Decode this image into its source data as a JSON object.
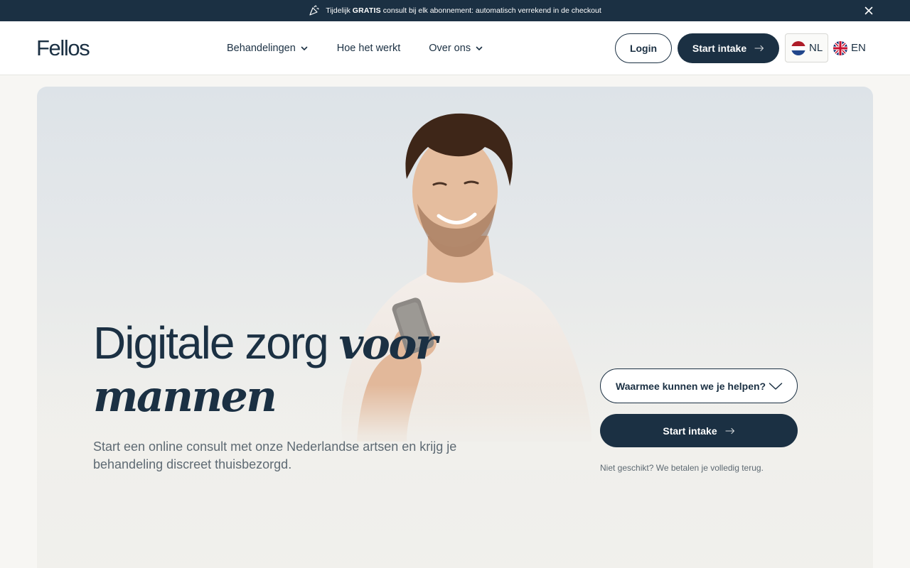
{
  "announcement": {
    "prefix": "Tijdelijk ",
    "highlight": "GRATIS",
    "suffix": " consult bij elk abonnement: automatisch verrekend in de checkout"
  },
  "header": {
    "logo": "Fellos",
    "nav": [
      {
        "label": "Behandelingen",
        "has_dropdown": true
      },
      {
        "label": "Hoe het werkt",
        "has_dropdown": false
      },
      {
        "label": "Over ons",
        "has_dropdown": true
      }
    ],
    "login_label": "Login",
    "start_label": "Start intake",
    "languages": [
      {
        "code": "NL",
        "active": true
      },
      {
        "code": "EN",
        "active": false
      }
    ]
  },
  "hero": {
    "headline_plain": "Digitale zorg ",
    "headline_italic_1": "voor",
    "headline_italic_2": "mannen",
    "subtext": "Start een online consult met onze Nederlandse artsen en krijg je behandeling discreet thuisbezorgd.",
    "select_label": "Waarmee kunnen we je helpen?",
    "start_label": "Start intake",
    "guarantee": "Niet geschikt? We betalen je volledig terug."
  },
  "colors": {
    "primary": "#1b3043",
    "muted_text": "#5e6a73",
    "page_bg": "#f7f6f3"
  },
  "icons": [
    "party-popper-icon",
    "close-icon",
    "chevron-down-icon",
    "arrow-right-icon",
    "flag-nl-icon",
    "flag-uk-icon"
  ]
}
